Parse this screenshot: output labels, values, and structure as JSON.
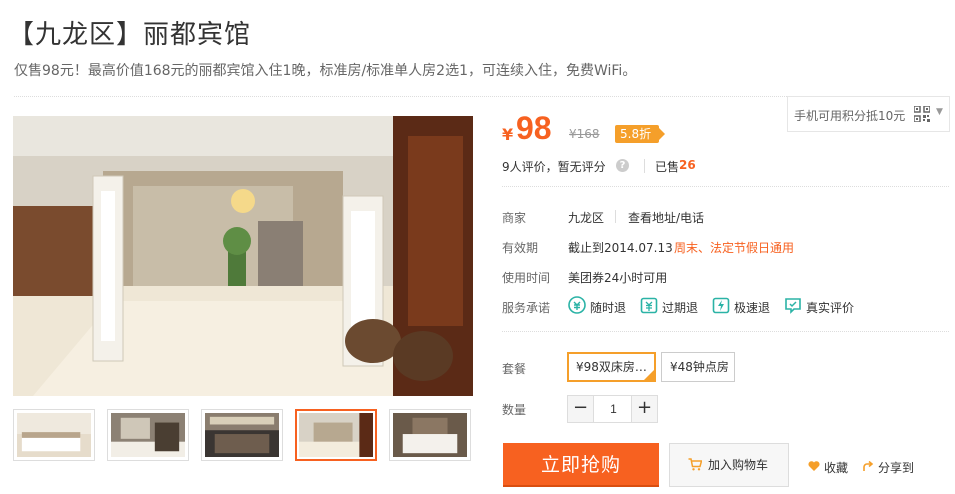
{
  "deal": {
    "title": "【九龙区】丽都宾馆",
    "subtitle": "仅售98元！最高价值168元的丽都宾馆入住1晚，标准房/标准单人房2选1，可连续入住，免费WiFi。"
  },
  "price": {
    "currency": "¥",
    "current": "98",
    "original": "¥168",
    "discount": "5.8折"
  },
  "mobile": {
    "text": "手机可用积分抵10元",
    "caret": "▼"
  },
  "rating": {
    "reviews": "9人评价，暂无评分",
    "help": "?",
    "sold_label": "已售",
    "sold_count": "26"
  },
  "merchant": {
    "label": "商家",
    "name": "九龙区",
    "link": "查看地址/电话"
  },
  "validity": {
    "label": "有效期",
    "value": "截止到2014.07.13",
    "note": "周末、法定节假日通用"
  },
  "usage": {
    "label": "使用时间",
    "value": "美团券24小时可用"
  },
  "promises": {
    "label": "服务承诺",
    "items": [
      {
        "label": "随时退",
        "icon": "refund-anytime-icon"
      },
      {
        "label": "过期退",
        "icon": "expired-refund-icon"
      },
      {
        "label": "极速退",
        "icon": "fast-refund-icon"
      },
      {
        "label": "真实评价",
        "icon": "real-review-icon"
      }
    ]
  },
  "package": {
    "label": "套餐",
    "options": [
      "¥98双床房…",
      "¥48钟点房"
    ],
    "selected": 0
  },
  "quantity": {
    "label": "数量",
    "minus": "−",
    "value": "1",
    "plus": "+"
  },
  "actions": {
    "buy": "立即抢购",
    "cart": "加入购物车",
    "favorite": "收藏",
    "share": "分享到"
  },
  "colors": {
    "accent": "#f76120",
    "badge": "#f59f2a",
    "icon_teal": "#2bb3a6"
  }
}
